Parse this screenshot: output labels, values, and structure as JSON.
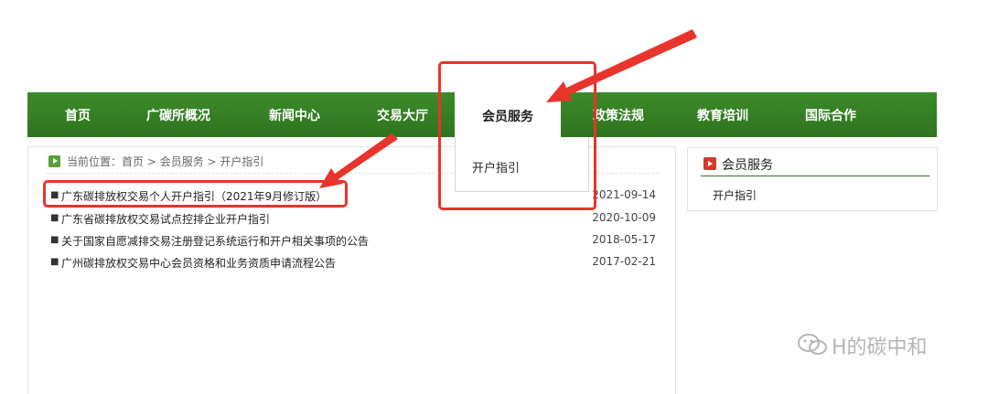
{
  "nav": {
    "items": [
      {
        "label": "首页"
      },
      {
        "label": "广碳所概况"
      },
      {
        "label": "新闻中心"
      },
      {
        "label": "交易大厅"
      },
      {
        "label": "会员服务"
      },
      {
        "label": "政策法规"
      },
      {
        "label": "教育培训"
      },
      {
        "label": "国际合作"
      }
    ],
    "active_index": 4
  },
  "dropdown": {
    "items": [
      {
        "label": "开户指引"
      }
    ]
  },
  "breadcrumb": {
    "label": "当前位置：",
    "home": "首页",
    "sep": " > ",
    "section": "会员服务",
    "page": "开户指引"
  },
  "news": [
    {
      "title": "广东碳排放权交易个人开户指引（2021年9月修订版）",
      "date": "2021-09-14"
    },
    {
      "title": "广东省碳排放权交易试点控排企业开户指引",
      "date": "2020-10-09"
    },
    {
      "title": "关于国家自愿减排交易注册登记系统运行和开户相关事项的公告",
      "date": "2018-05-17"
    },
    {
      "title": "广州碳排放权交易中心会员资格和业务资质申请流程公告",
      "date": "2017-02-21"
    }
  ],
  "sidebar": {
    "title": "会员服务",
    "links": [
      {
        "label": "开户指引"
      }
    ]
  },
  "watermark": {
    "text": "H的碳中和"
  },
  "colors": {
    "nav_green": "#2f7420",
    "annotation_red": "#e8342a"
  }
}
